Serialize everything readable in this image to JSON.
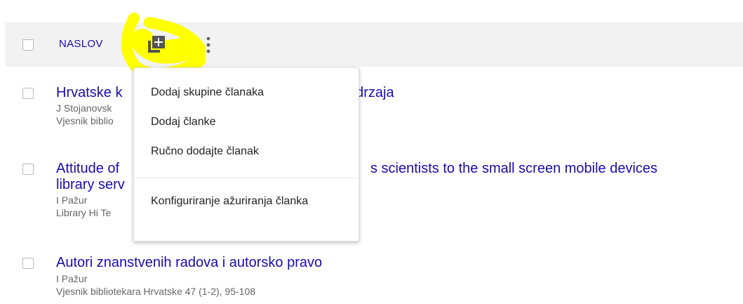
{
  "header": {
    "column_label": "NASLOV"
  },
  "articles": [
    {
      "title_visible_left": "Hrvatske k",
      "title_visible_right": "adrzaja",
      "authors": "J Stojanovsk",
      "source": "Vjesnik biblio"
    },
    {
      "title_line1_left": "Attitude of",
      "title_line1_right": "s scientists to the small screen mobile devices",
      "title_line2": "library serv",
      "authors": "I Pažur",
      "source": "Library Hi Te"
    },
    {
      "title": "Autori znanstvenih radova i autorsko pravo",
      "authors": "I Pažur",
      "source": "Vjesnik bibliotekara Hrvatske 47 (1-2), 95-108"
    }
  ],
  "menu": {
    "items": [
      "Dodaj skupine članaka",
      "Dodaj članke",
      "Ručno dodajte članak",
      "Konfiguriranje ažuriranja članka"
    ]
  },
  "colors": {
    "link": "#1a0dab",
    "highlight": "#ffff00",
    "header_bg": "#f2f2f2",
    "meta_text": "#666666"
  },
  "icons": {
    "add": "add-box-icon",
    "more": "more-vert-icon"
  }
}
